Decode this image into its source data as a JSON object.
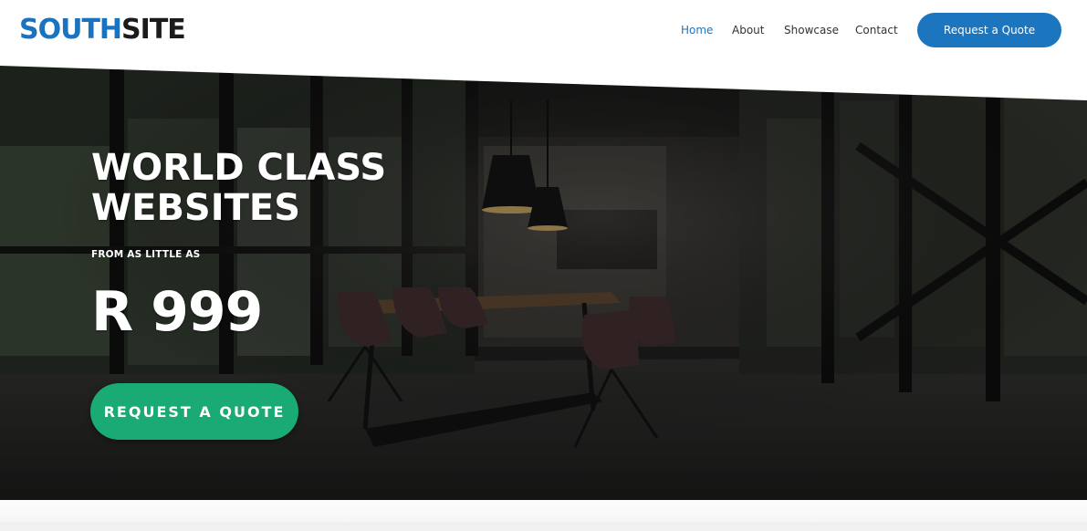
{
  "header": {
    "logo": {
      "part1": "SOUTH",
      "part2": "SITE"
    },
    "nav": [
      {
        "label": "Home",
        "active": true
      },
      {
        "label": "About",
        "active": false
      },
      {
        "label": "Showcase",
        "active": false
      },
      {
        "label": "Contact",
        "active": false
      }
    ],
    "cta_label": "Request a Quote"
  },
  "hero": {
    "headline_line1": "WORLD CLASS",
    "headline_line2": "WEBSITES",
    "subline": "FROM AS LITTLE AS",
    "price": "R 999",
    "cta_label": "REQUEST A QUOTE",
    "background": "office-meeting-room-photo"
  },
  "colors": {
    "brand_blue": "#1b75bf",
    "logo_dark": "#1b1b1b",
    "cta_green": "#1aaa73",
    "nav_active": "#2474b8"
  }
}
